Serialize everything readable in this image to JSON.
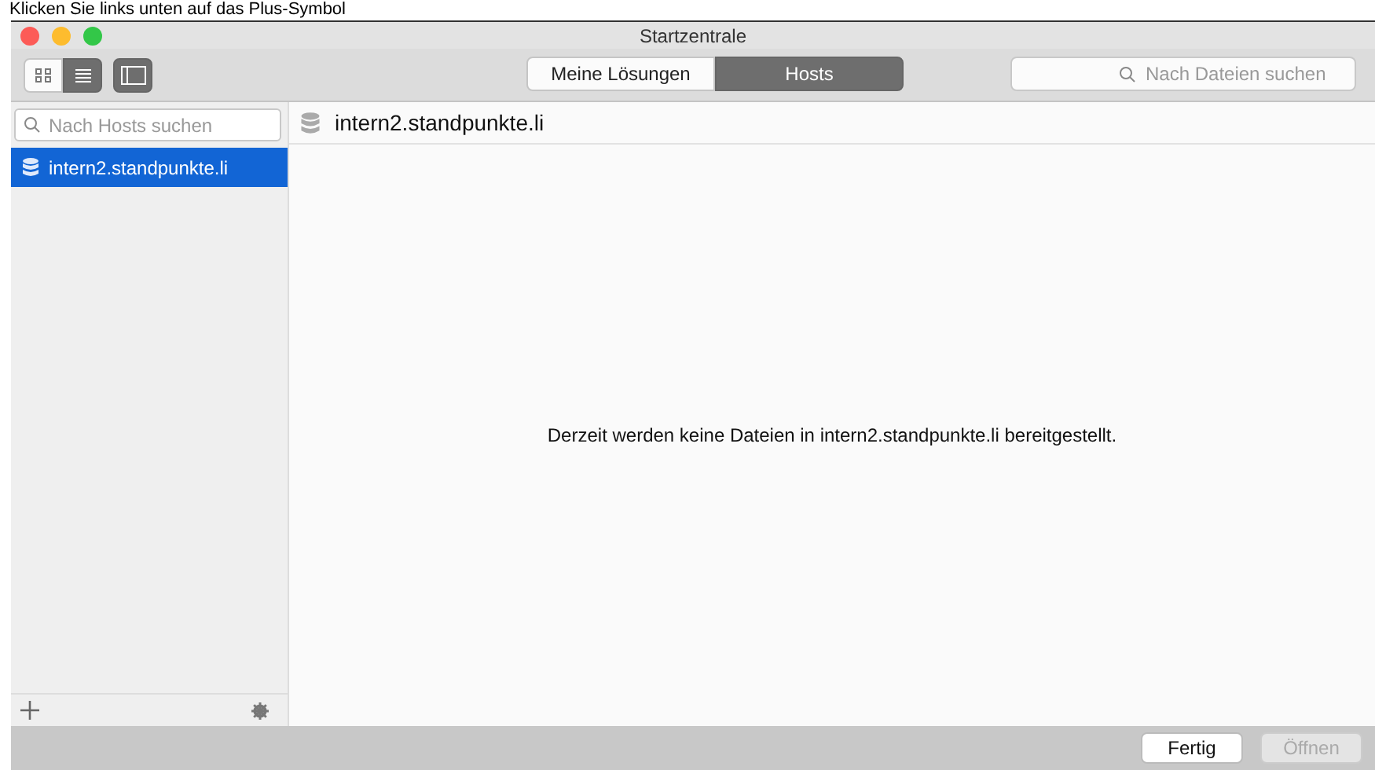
{
  "caption": "Klicken Sie links unten auf das Plus-Symbol",
  "window": {
    "title": "Startzentrale"
  },
  "view_buttons": [
    {
      "kind": "grid",
      "selected": false
    },
    {
      "kind": "list",
      "selected": true
    },
    {
      "kind": "sidebar",
      "selected": true
    }
  ],
  "segments": [
    {
      "label": "Meine Lösungen",
      "selected": false
    },
    {
      "label": "Hosts",
      "selected": true
    }
  ],
  "file_search": {
    "placeholder": "Nach Dateien suchen"
  },
  "host_search": {
    "placeholder": "Nach Hosts suchen"
  },
  "hosts": [
    {
      "label": "intern2.standpunkte.li",
      "selected": true
    }
  ],
  "detail": {
    "title": "intern2.standpunkte.li",
    "message": "Derzeit werden keine Dateien in intern2.standpunkte.li bereitgestellt."
  },
  "buttons": [
    {
      "label": "Fertig",
      "disabled": false
    },
    {
      "label": "Öffnen",
      "disabled": true
    }
  ]
}
